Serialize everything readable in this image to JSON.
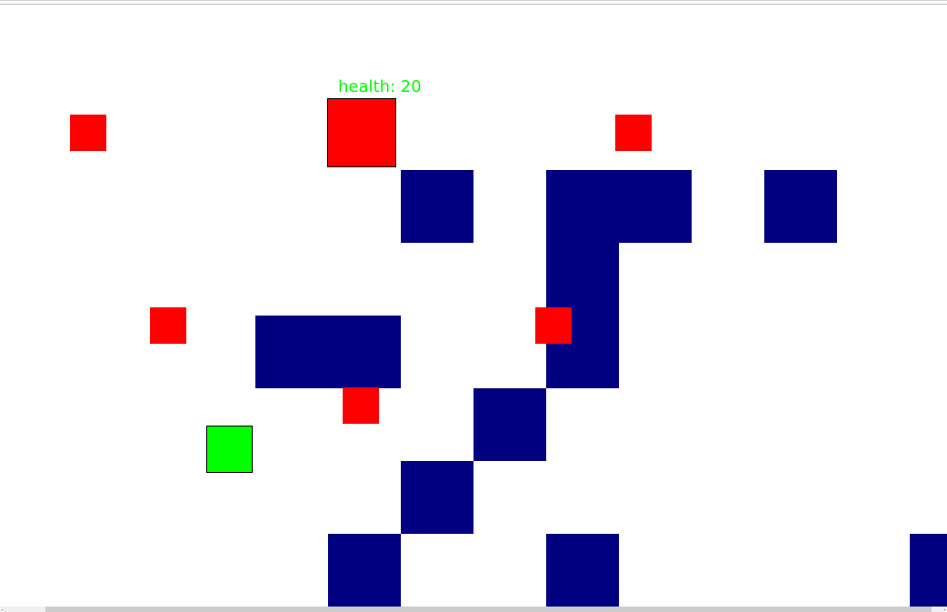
{
  "colors": {
    "background": "#ffffff",
    "wall": "#000080",
    "enemy": "#ff0000",
    "boss": "#ff0000",
    "player": "#00ff00",
    "health_text": "#00ff00"
  },
  "boss": {
    "health_text": "health: 20"
  }
}
